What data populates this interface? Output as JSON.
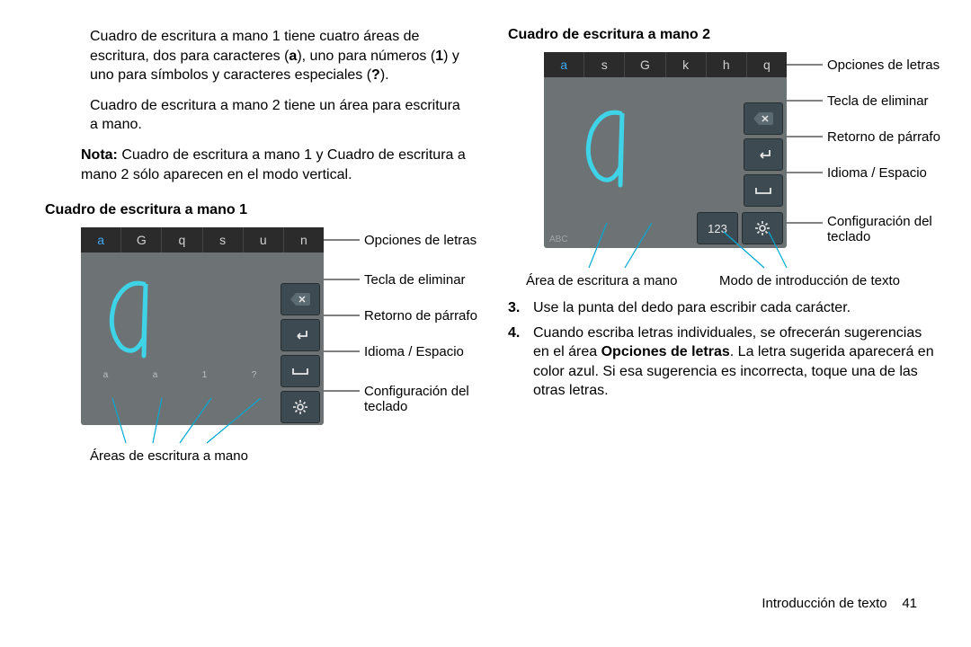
{
  "left": {
    "para1_a": "Cuadro de escritura a mano 1 tiene cuatro áreas de escritura, dos para caracteres (",
    "para1_b": "), uno para números (",
    "para1_c": ") y uno para símbolos y caracteres especiales (",
    "para1_d": ").",
    "bold_a": "a",
    "bold_1": "1",
    "bold_q": "?",
    "para2": "Cuadro de escritura a mano 2 tiene un área para escritura a mano.",
    "note_label": "Nota:",
    "note_text": " Cuadro de escritura a mano 1 y Cuadro de escritura a mano 2 sólo aparecen en el modo vertical.",
    "section1_title": "Cuadro de escritura a mano 1",
    "kb1_letters": [
      "a",
      "G",
      "q",
      "s",
      "u",
      "n"
    ],
    "kb1_area_hints": [
      "a",
      "a",
      "1",
      "?"
    ],
    "label_opciones": "Opciones de letras",
    "label_eliminar": "Tecla de eliminar",
    "label_retorno": "Retorno de párrafo",
    "label_idioma": "Idioma / Espacio",
    "label_config": "Configuración del teclado",
    "bottom1": "Áreas de escritura a mano"
  },
  "right": {
    "section2_title": "Cuadro de escritura a mano 2",
    "kb2_letters": [
      "a",
      "s",
      "G",
      "k",
      "h",
      "q"
    ],
    "label_opciones": "Opciones de letras",
    "label_eliminar": "Tecla de eliminar",
    "label_retorno": "Retorno de párrafo",
    "label_idioma": "Idioma / Espacio",
    "label_config": "Configuración del teclado",
    "key_123": "123",
    "abc": "ABC",
    "bottom_area": "Área de escritura a mano",
    "bottom_modo": "Modo de introducción de texto",
    "step3_num": "3.",
    "step3": "Use la punta del dedo para escribir cada carácter.",
    "step4_num": "4.",
    "step4_a": "Cuando escriba letras individuales, se ofrecerán sugerencias en el área ",
    "step4_bold": "Opciones de letras",
    "step4_b": ". La letra sugerida aparecerá en color azul. Si esa sugerencia es incorrecta, toque una de las otras letras."
  },
  "footer": {
    "label": "Introducción de texto",
    "page": "41"
  }
}
